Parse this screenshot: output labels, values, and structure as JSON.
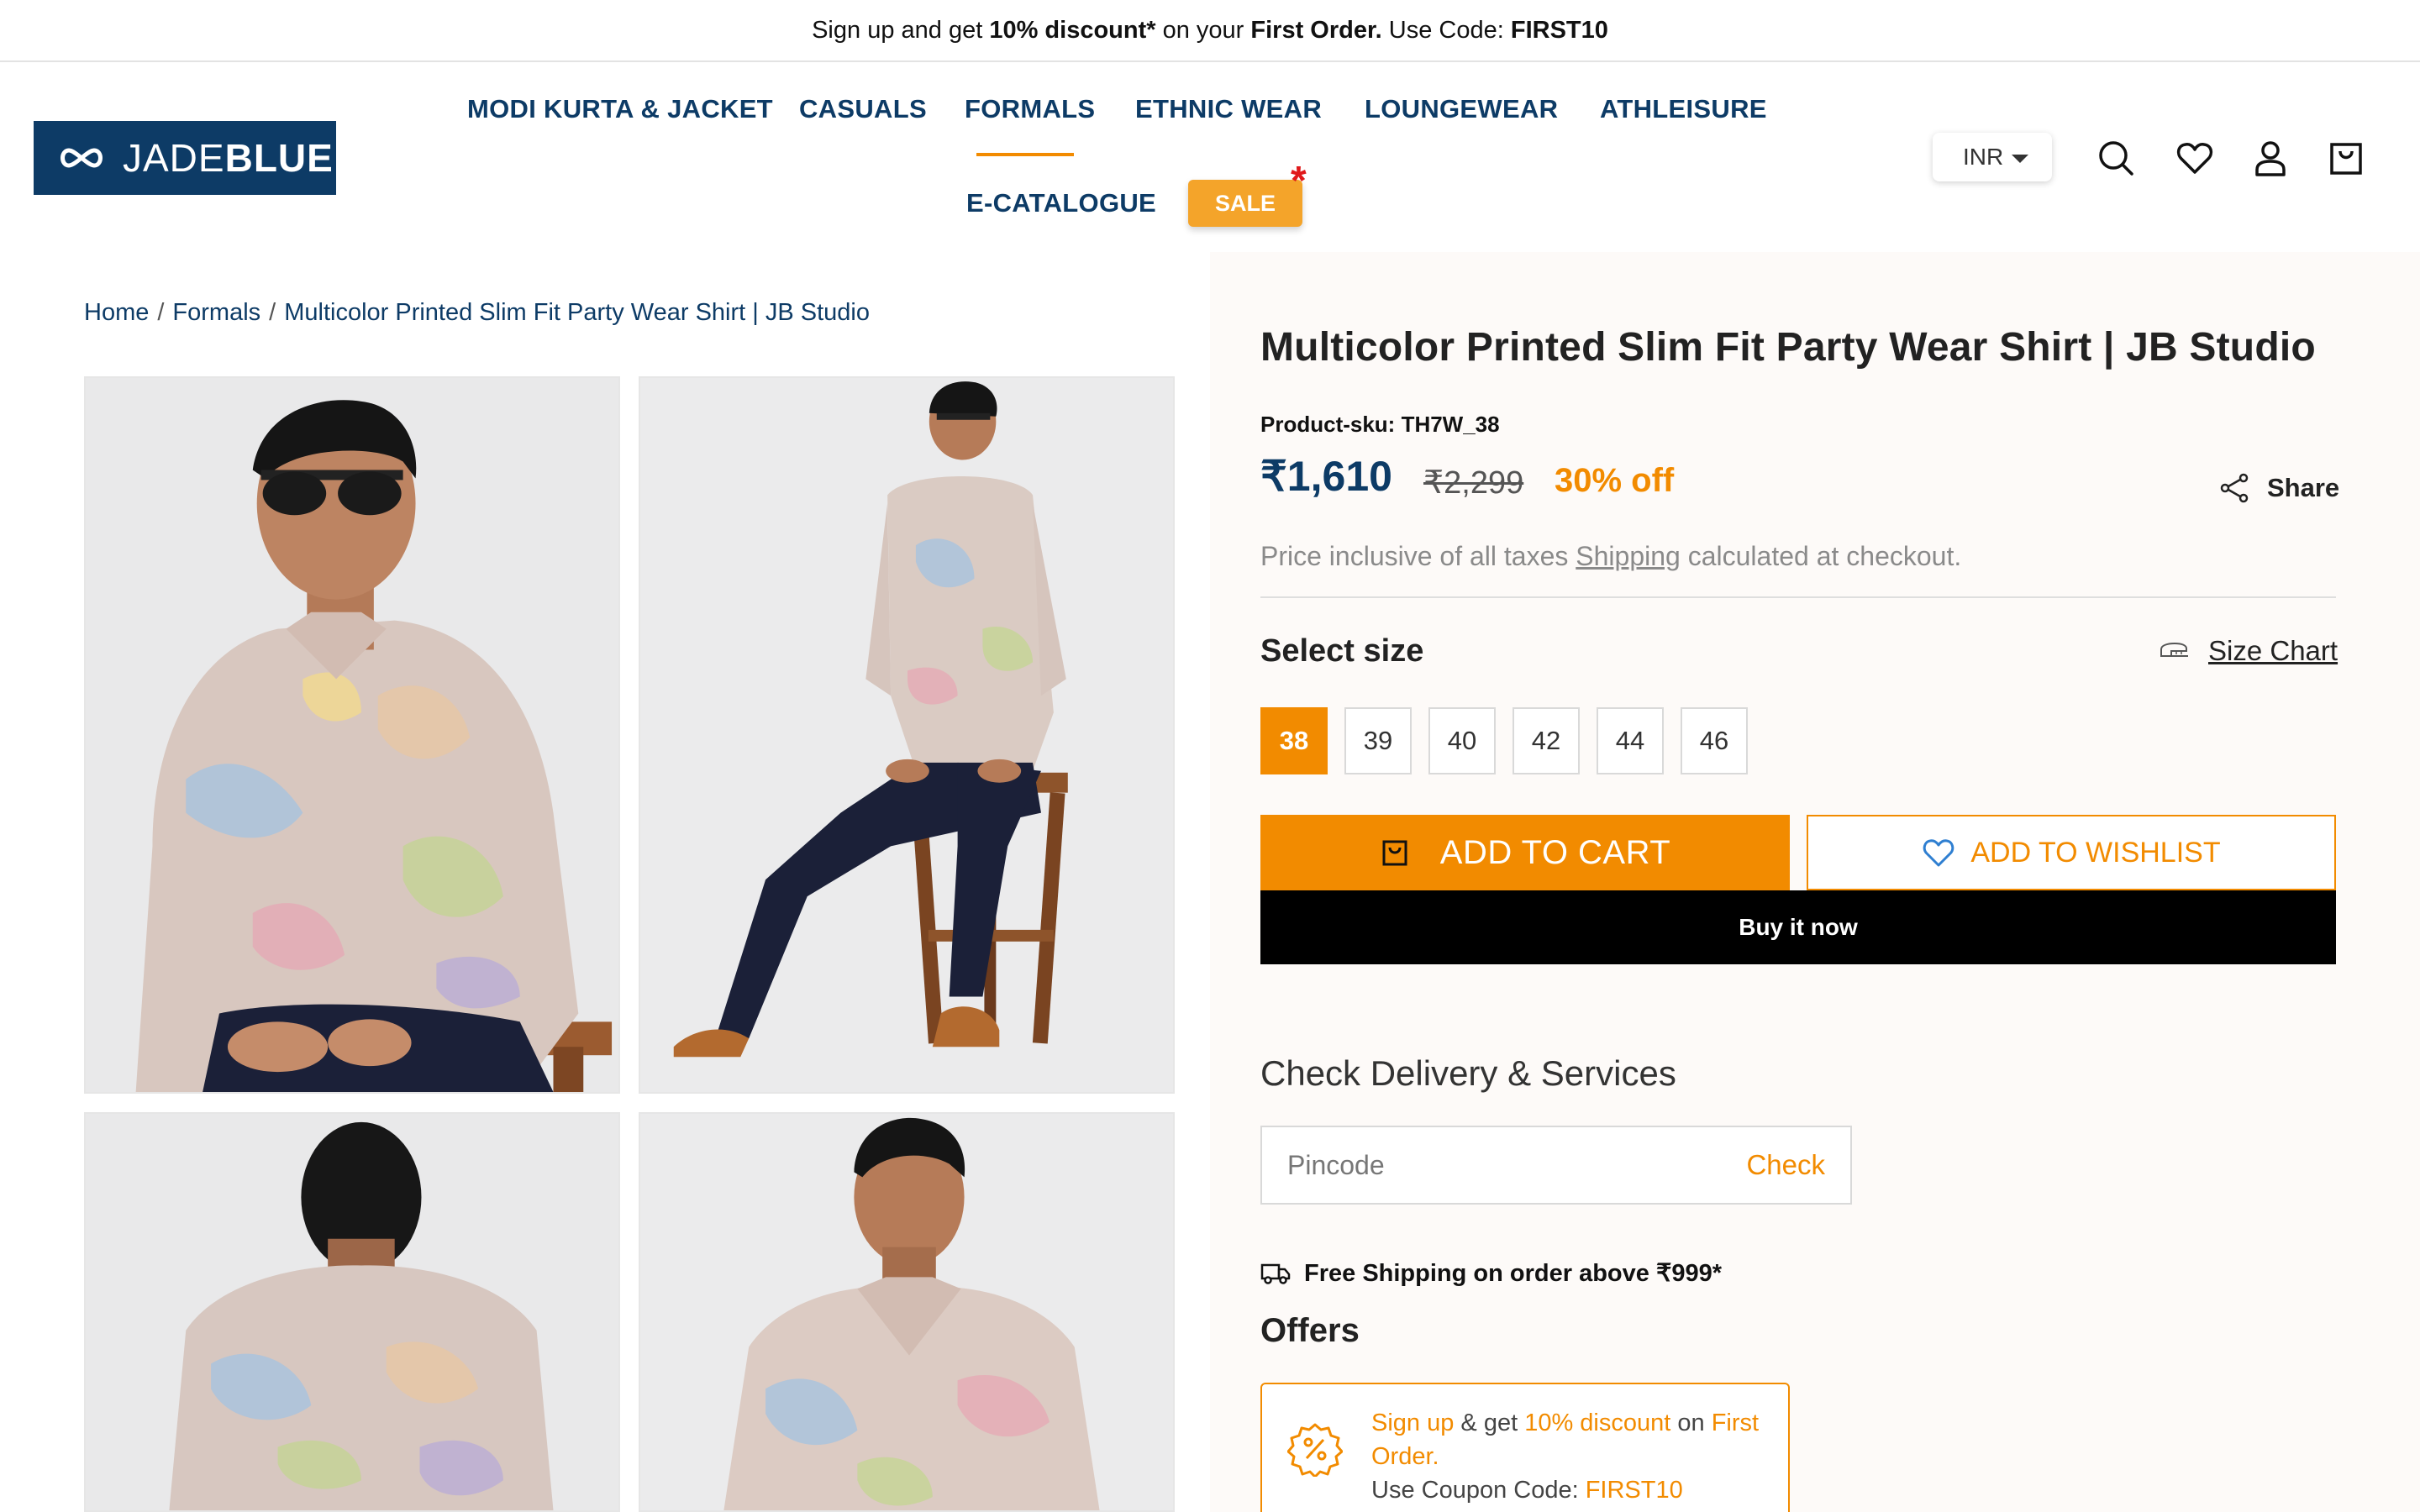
{
  "announcement": {
    "pre": "Sign up and get ",
    "discount": "10% discount*",
    "mid": " on your ",
    "first_order": "First Order.",
    "code_label": " Use Code: ",
    "code": "FIRST10"
  },
  "brand": {
    "logo_light": "JADE",
    "logo_bold": "BLUE"
  },
  "nav": {
    "items": [
      "MODI KURTA & JACKET",
      "CASUALS",
      "FORMALS",
      "ETHNIC WEAR",
      "LOUNGEWEAR",
      "ATHLEISURE",
      "E-CATALOGUE"
    ],
    "active": "FORMALS",
    "sale": "SALE",
    "sale_star": "*"
  },
  "header": {
    "currency": "INR",
    "icons": [
      "search-icon",
      "heart-icon",
      "user-icon",
      "bag-icon"
    ]
  },
  "breadcrumb": {
    "home": "Home",
    "sep": "/",
    "category": "Formals",
    "current": "Multicolor Printed Slim Fit Party Wear Shirt | JB Studio"
  },
  "gallery": {
    "images": [
      "front-seated-sunglasses",
      "full-seated-stool",
      "back-view",
      "front-portrait"
    ]
  },
  "product": {
    "title": "Multicolor Printed Slim Fit Party Wear Shirt | JB Studio",
    "sku": "Product-sku: TH7W_38",
    "price": "₹1,610",
    "mrp": "₹2,299",
    "discount": "30% off",
    "share": "Share",
    "tax_pre": "Price inclusive of all taxes ",
    "tax_link": "Shipping",
    "tax_post": " calculated at checkout.",
    "select_size": "Select size",
    "size_chart": "Size Chart",
    "sizes": [
      "38",
      "39",
      "40",
      "42",
      "44",
      "46"
    ],
    "selected_size": "38",
    "add_to_cart": "ADD TO CART",
    "add_to_wishlist": "ADD TO WISHLIST",
    "buy_now": "Buy it now"
  },
  "delivery": {
    "heading": "Check Delivery & Services",
    "placeholder": "Pincode",
    "check": "Check",
    "free_shipping": "Free Shipping on order above ₹999*"
  },
  "offers": {
    "heading": "Offers",
    "card": {
      "signup": "Sign up",
      "and_get": " & get ",
      "discount": "10% discount",
      "on": " on ",
      "first_order": "First Order.",
      "coupon_label": "Use Coupon Code: ",
      "coupon": "FIRST10"
    }
  },
  "colors": {
    "navy": "#0d3b66",
    "orange": "#f28b00",
    "sale": "#f4a42a",
    "star": "#e0191b"
  }
}
